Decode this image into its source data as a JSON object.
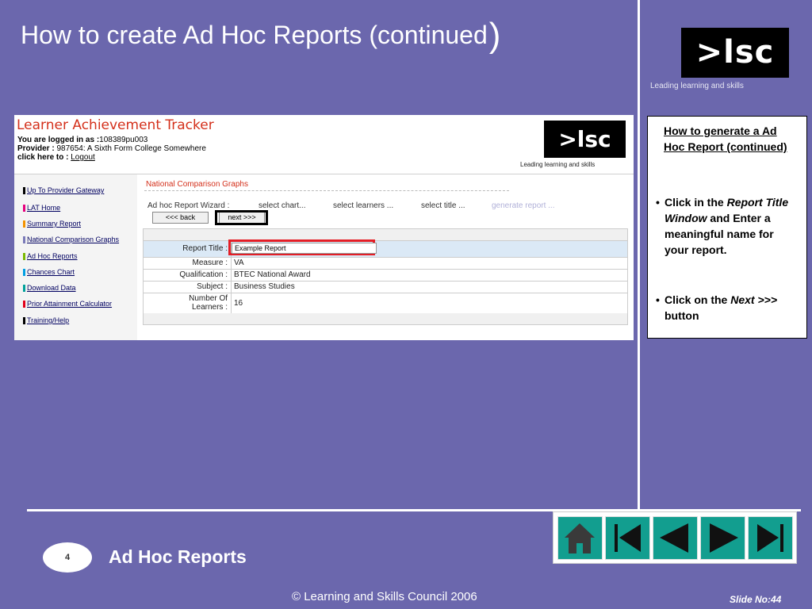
{
  "slide": {
    "title": "How to create Ad Hoc Reports (continued",
    "title_paren": ")",
    "logo_text": ">lsc",
    "logo_tagline": "Leading learning and skills",
    "section_number": "4",
    "section_title": "Ad Hoc Reports",
    "copyright": "© Learning and Skills Council 2006",
    "slide_no": "Slide No:44"
  },
  "app": {
    "title": "Learner Achievement Tracker",
    "logged_in_label": "You are logged in as :",
    "logged_in_value": "108389pu003",
    "provider_label": "Provider :",
    "provider_value": "987654: A Sixth Form College Somewhere",
    "click_label": "click here to :",
    "logout": "Logout",
    "logo_text": ">lsc",
    "logo_tagline": "Leading learning and skills",
    "page_heading": "National Comparison Graphs"
  },
  "sidebar": {
    "items": [
      {
        "label": "Up To Provider Gateway",
        "color": "#000000"
      },
      {
        "label": "LAT Home",
        "color": "#e6007e"
      },
      {
        "label": "Summary Report",
        "color": "#f39200"
      },
      {
        "label": "National Comparison Graphs",
        "color": "#7a7ab8"
      },
      {
        "label": "Ad Hoc Reports",
        "color": "#7ab800"
      },
      {
        "label": "Chances Chart",
        "color": "#009fe3"
      },
      {
        "label": "Download Data",
        "color": "#00a19a"
      },
      {
        "label": "Prior Attainment Calculator",
        "color": "#e2001a"
      },
      {
        "label": "Training/Help",
        "color": "#000000"
      }
    ]
  },
  "wizard": {
    "label": "Ad hoc Report Wizard :",
    "steps": [
      "select chart...",
      "select learners ...",
      "select title ...",
      "generate report ..."
    ],
    "back_button": "<<< back",
    "next_button": "next >>>"
  },
  "form": {
    "rows": [
      {
        "label": "Report Title :",
        "value": "Example Report"
      },
      {
        "label": "Measure :",
        "value": "VA"
      },
      {
        "label": "Qualification :",
        "value": "BTEC National Award"
      },
      {
        "label": "Subject :",
        "value": "Business Studies"
      },
      {
        "label": "Number Of",
        "label2": "Learners :",
        "value": "16"
      }
    ]
  },
  "note": {
    "heading": "How to generate a Ad Hoc Report (continued)",
    "b1_pre": "Click in the ",
    "b1_em": "Report Title Window",
    "b1_post": " and Enter a meaningful name for your report.",
    "b2_pre": "Click on the ",
    "b2_em": "Next >>>",
    "b2_post": " button"
  },
  "nav": {
    "color": "#129e8f",
    "buttons": [
      "home-icon",
      "first-slide-icon",
      "previous-slide-icon",
      "next-slide-icon",
      "last-slide-icon"
    ]
  }
}
